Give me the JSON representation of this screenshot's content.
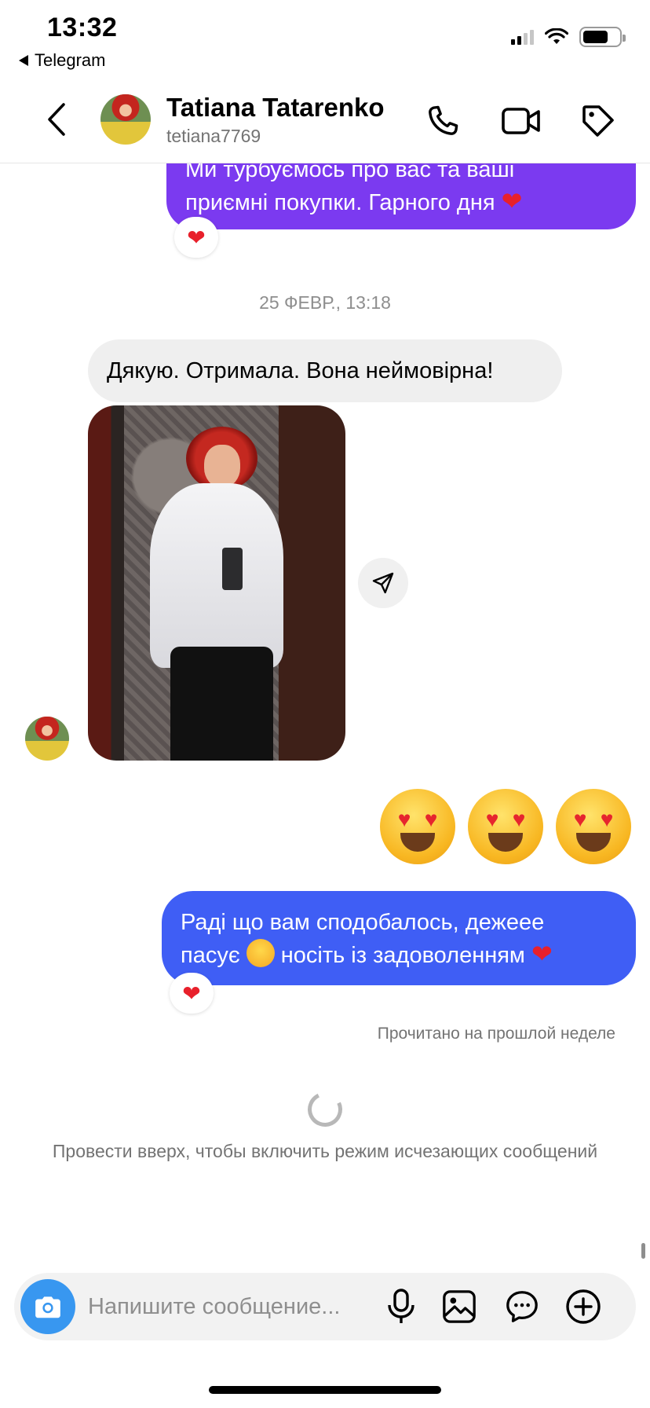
{
  "status_bar": {
    "time": "13:32",
    "back_app": "Telegram"
  },
  "header": {
    "name": "Tatiana Tatarenko",
    "username": "tetiana7769",
    "icons": [
      "back-chevron-icon",
      "phone-icon",
      "video-call-icon",
      "tag-icon"
    ]
  },
  "messages": {
    "outgoing_1": {
      "line1": "Ми турбуємось про вас та ваші",
      "line2": "приємні покупки. Гарного  дня",
      "reaction": "❤️"
    },
    "timestamp": "25 ФЕВР., 13:18",
    "incoming_1": "Дякую. Отримала. Вона неймовірна!",
    "big_emojis": [
      "😍",
      "😍",
      "😍"
    ],
    "outgoing_2": {
      "line1": "Раді що вам сподобалось, дежеее",
      "line2_a": "пасує",
      "line2_b": "носіть із задоволенням",
      "reaction": "❤️"
    }
  },
  "read_receipt": "Прочитано на прошлой неделе",
  "vanish_hint": "Провести вверх, чтобы включить режим исчезающих сообщений",
  "composer": {
    "placeholder": "Напишите сообщение...",
    "icons": [
      "camera-icon",
      "microphone-icon",
      "gallery-icon",
      "sticker-chat-icon",
      "add-icon"
    ]
  },
  "colors": {
    "outgoing_purple": "#7b3af0",
    "outgoing_blue": "#3f5ef5",
    "incoming_gray": "#efefef",
    "camera_blue": "#3897f0"
  }
}
